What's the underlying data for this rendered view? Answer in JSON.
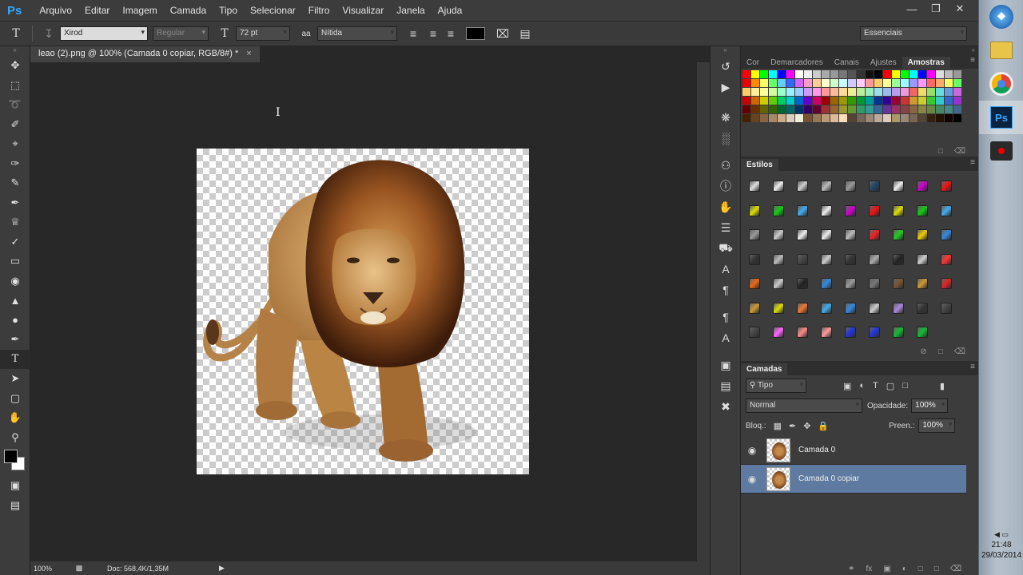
{
  "app": {
    "logo": "Ps"
  },
  "menu": [
    "Arquivo",
    "Editar",
    "Imagem",
    "Camada",
    "Tipo",
    "Selecionar",
    "Filtro",
    "Visualizar",
    "Janela",
    "Ajuda"
  ],
  "options": {
    "font_family": "Xirod",
    "font_style": "Regular",
    "font_size": "72 pt",
    "aa_label": "aa",
    "antialias": "Nítida",
    "workspace": "Essenciais"
  },
  "document": {
    "tab_title": "leao (2).png @ 100% (Camada 0 copiar, RGB/8#) *",
    "zoom": "100%",
    "doc_info": "Doc: 568,4K/1,35M"
  },
  "swatch_panel": {
    "tabs": [
      "Cor",
      "Demarcadores",
      "Canais",
      "Ajustes",
      "Amostras"
    ],
    "active_tab": "Amostras"
  },
  "styles_panel": {
    "title": "Estilos"
  },
  "layers_panel": {
    "title": "Camadas",
    "filter": "Tipo",
    "blend_mode": "Normal",
    "opacity_label": "Opacidade:",
    "opacity": "100%",
    "lock_label": "Bloq.:",
    "fill_label": "Preen.:",
    "fill": "100%",
    "layers": [
      {
        "name": "Camada 0",
        "selected": false
      },
      {
        "name": "Camada 0 copiar",
        "selected": true
      }
    ]
  },
  "taskbar": {
    "time": "21:48",
    "date": "29/03/2014"
  },
  "colors": {
    "accent": "#31a8ff",
    "selection": "#5e7aa0"
  }
}
